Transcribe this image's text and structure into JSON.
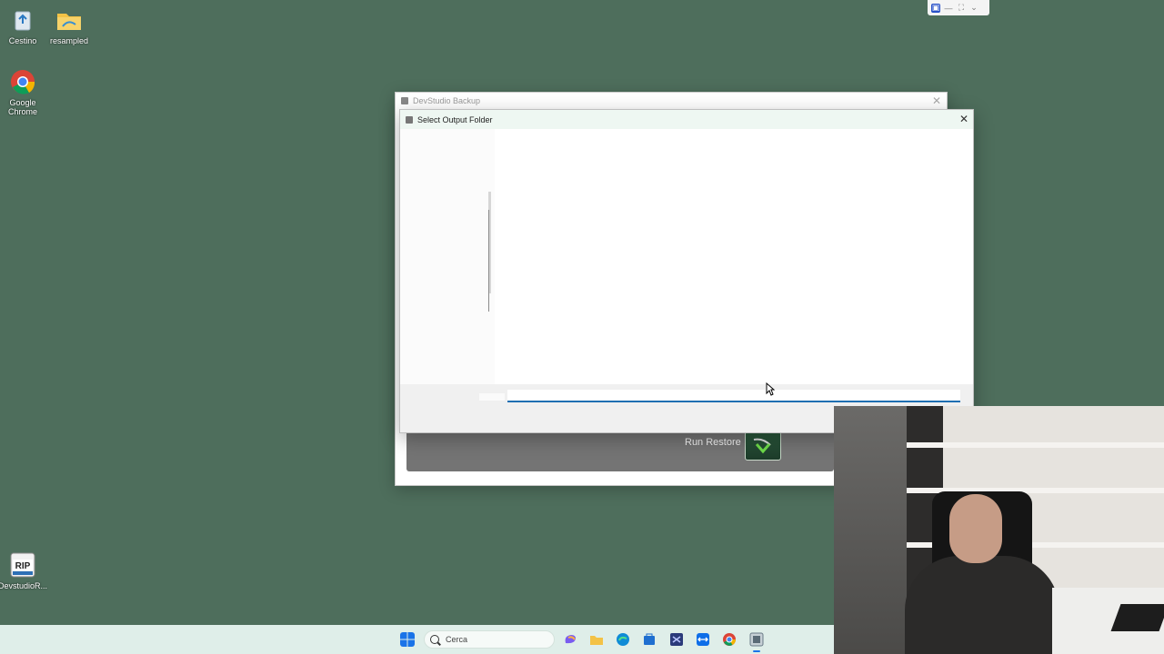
{
  "desktop": {
    "icons": [
      {
        "label": "Cestino"
      },
      {
        "label": "resampled"
      },
      {
        "label": "Google Chrome"
      },
      {
        "label": "DevstudioR..."
      }
    ]
  },
  "back_window": {
    "title": "DevStudio Backup",
    "run_restore_label": "Run Restore"
  },
  "dialog": {
    "title": "Select Output Folder",
    "folder_value": ""
  },
  "taskbar": {
    "search_placeholder": "Cerca"
  },
  "colors": {
    "desktop_bg": "#4e6e5c",
    "accent": "#1f6fb2"
  }
}
